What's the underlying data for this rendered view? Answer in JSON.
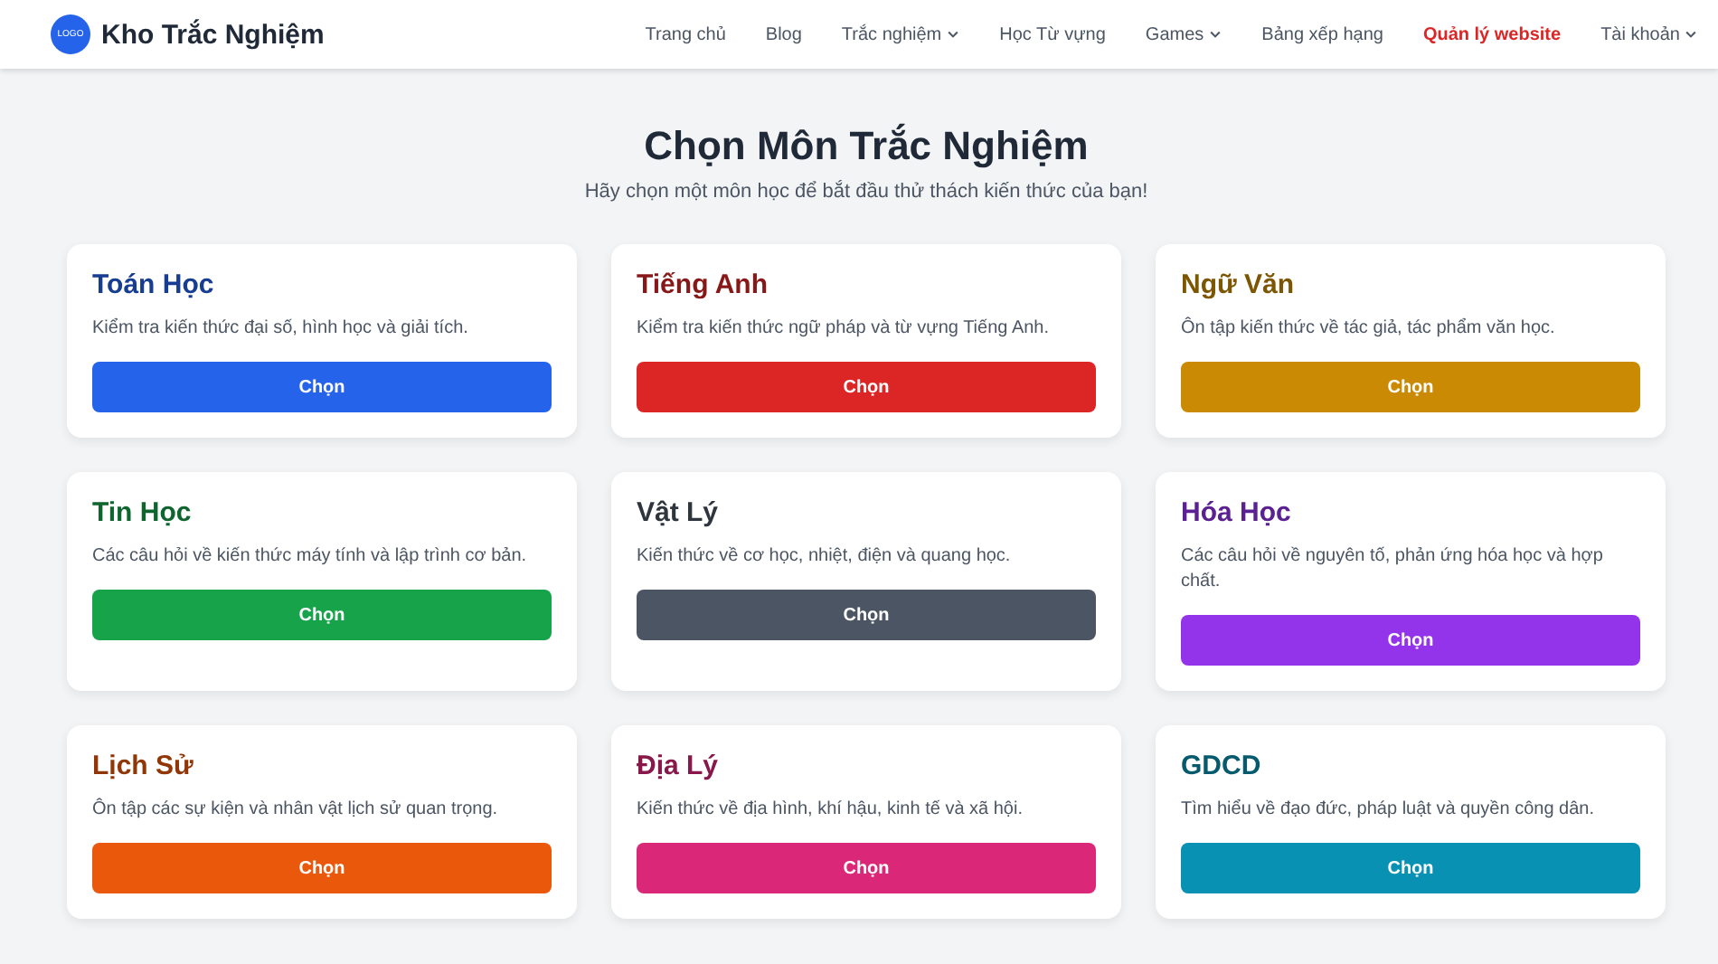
{
  "header": {
    "logo": "LOGO",
    "site_name": "Kho Trắc Nghiệm",
    "nav": [
      {
        "label": "Trang chủ",
        "dropdown": false,
        "kind": "normal"
      },
      {
        "label": "Blog",
        "dropdown": false,
        "kind": "normal"
      },
      {
        "label": "Trắc nghiệm",
        "dropdown": true,
        "kind": "normal"
      },
      {
        "label": "Học Từ vựng",
        "dropdown": false,
        "kind": "normal"
      },
      {
        "label": "Games",
        "dropdown": true,
        "kind": "normal"
      },
      {
        "label": "Bảng xếp hạng",
        "dropdown": false,
        "kind": "normal"
      },
      {
        "label": "Quản lý website",
        "dropdown": false,
        "kind": "admin"
      },
      {
        "label": "Tài khoản",
        "dropdown": true,
        "kind": "normal"
      }
    ]
  },
  "heading": "Chọn Môn Trắc Nghiệm",
  "subheading": "Hãy chọn một môn học để bắt đầu thử thách kiến thức của bạn!",
  "subjects": [
    {
      "title": "Toán Học",
      "description": "Kiểm tra kiến thức đại số, hình học và giải tích.",
      "button": "Chọn",
      "color": "#2563eb"
    },
    {
      "title": "Tiếng Anh",
      "description": "Kiểm tra kiến thức ngữ pháp và từ vựng Tiếng Anh.",
      "button": "Chọn",
      "color": "#dc2626"
    },
    {
      "title": "Ngữ Văn",
      "description": "Ôn tập kiến thức về tác giả, tác phẩm văn học.",
      "button": "Chọn",
      "color": "#ca8a04"
    },
    {
      "title": "Tin Học",
      "description": "Các câu hỏi về kiến thức máy tính và lập trình cơ bản.",
      "button": "Chọn",
      "color": "#16a34a"
    },
    {
      "title": "Vật Lý",
      "description": "Kiến thức về cơ học, nhiệt, điện và quang học.",
      "button": "Chọn",
      "color": "#4b5563"
    },
    {
      "title": "Hóa Học",
      "description": "Các câu hỏi về nguyên tố, phản ứng hóa học và hợp chất.",
      "button": "Chọn",
      "color": "#9333ea"
    },
    {
      "title": "Lịch Sử",
      "description": "Ôn tập các sự kiện và nhân vật lịch sử quan trọng.",
      "button": "Chọn",
      "color": "#ea580c"
    },
    {
      "title": "Địa Lý",
      "description": "Kiến thức về địa hình, khí hậu, kinh tế và xã hội.",
      "button": "Chọn",
      "color": "#db2777"
    },
    {
      "title": "GDCD",
      "description": "Tìm hiểu về đạo đức, pháp luật và quyền công dân.",
      "button": "Chọn",
      "color": "#0891b2"
    }
  ]
}
